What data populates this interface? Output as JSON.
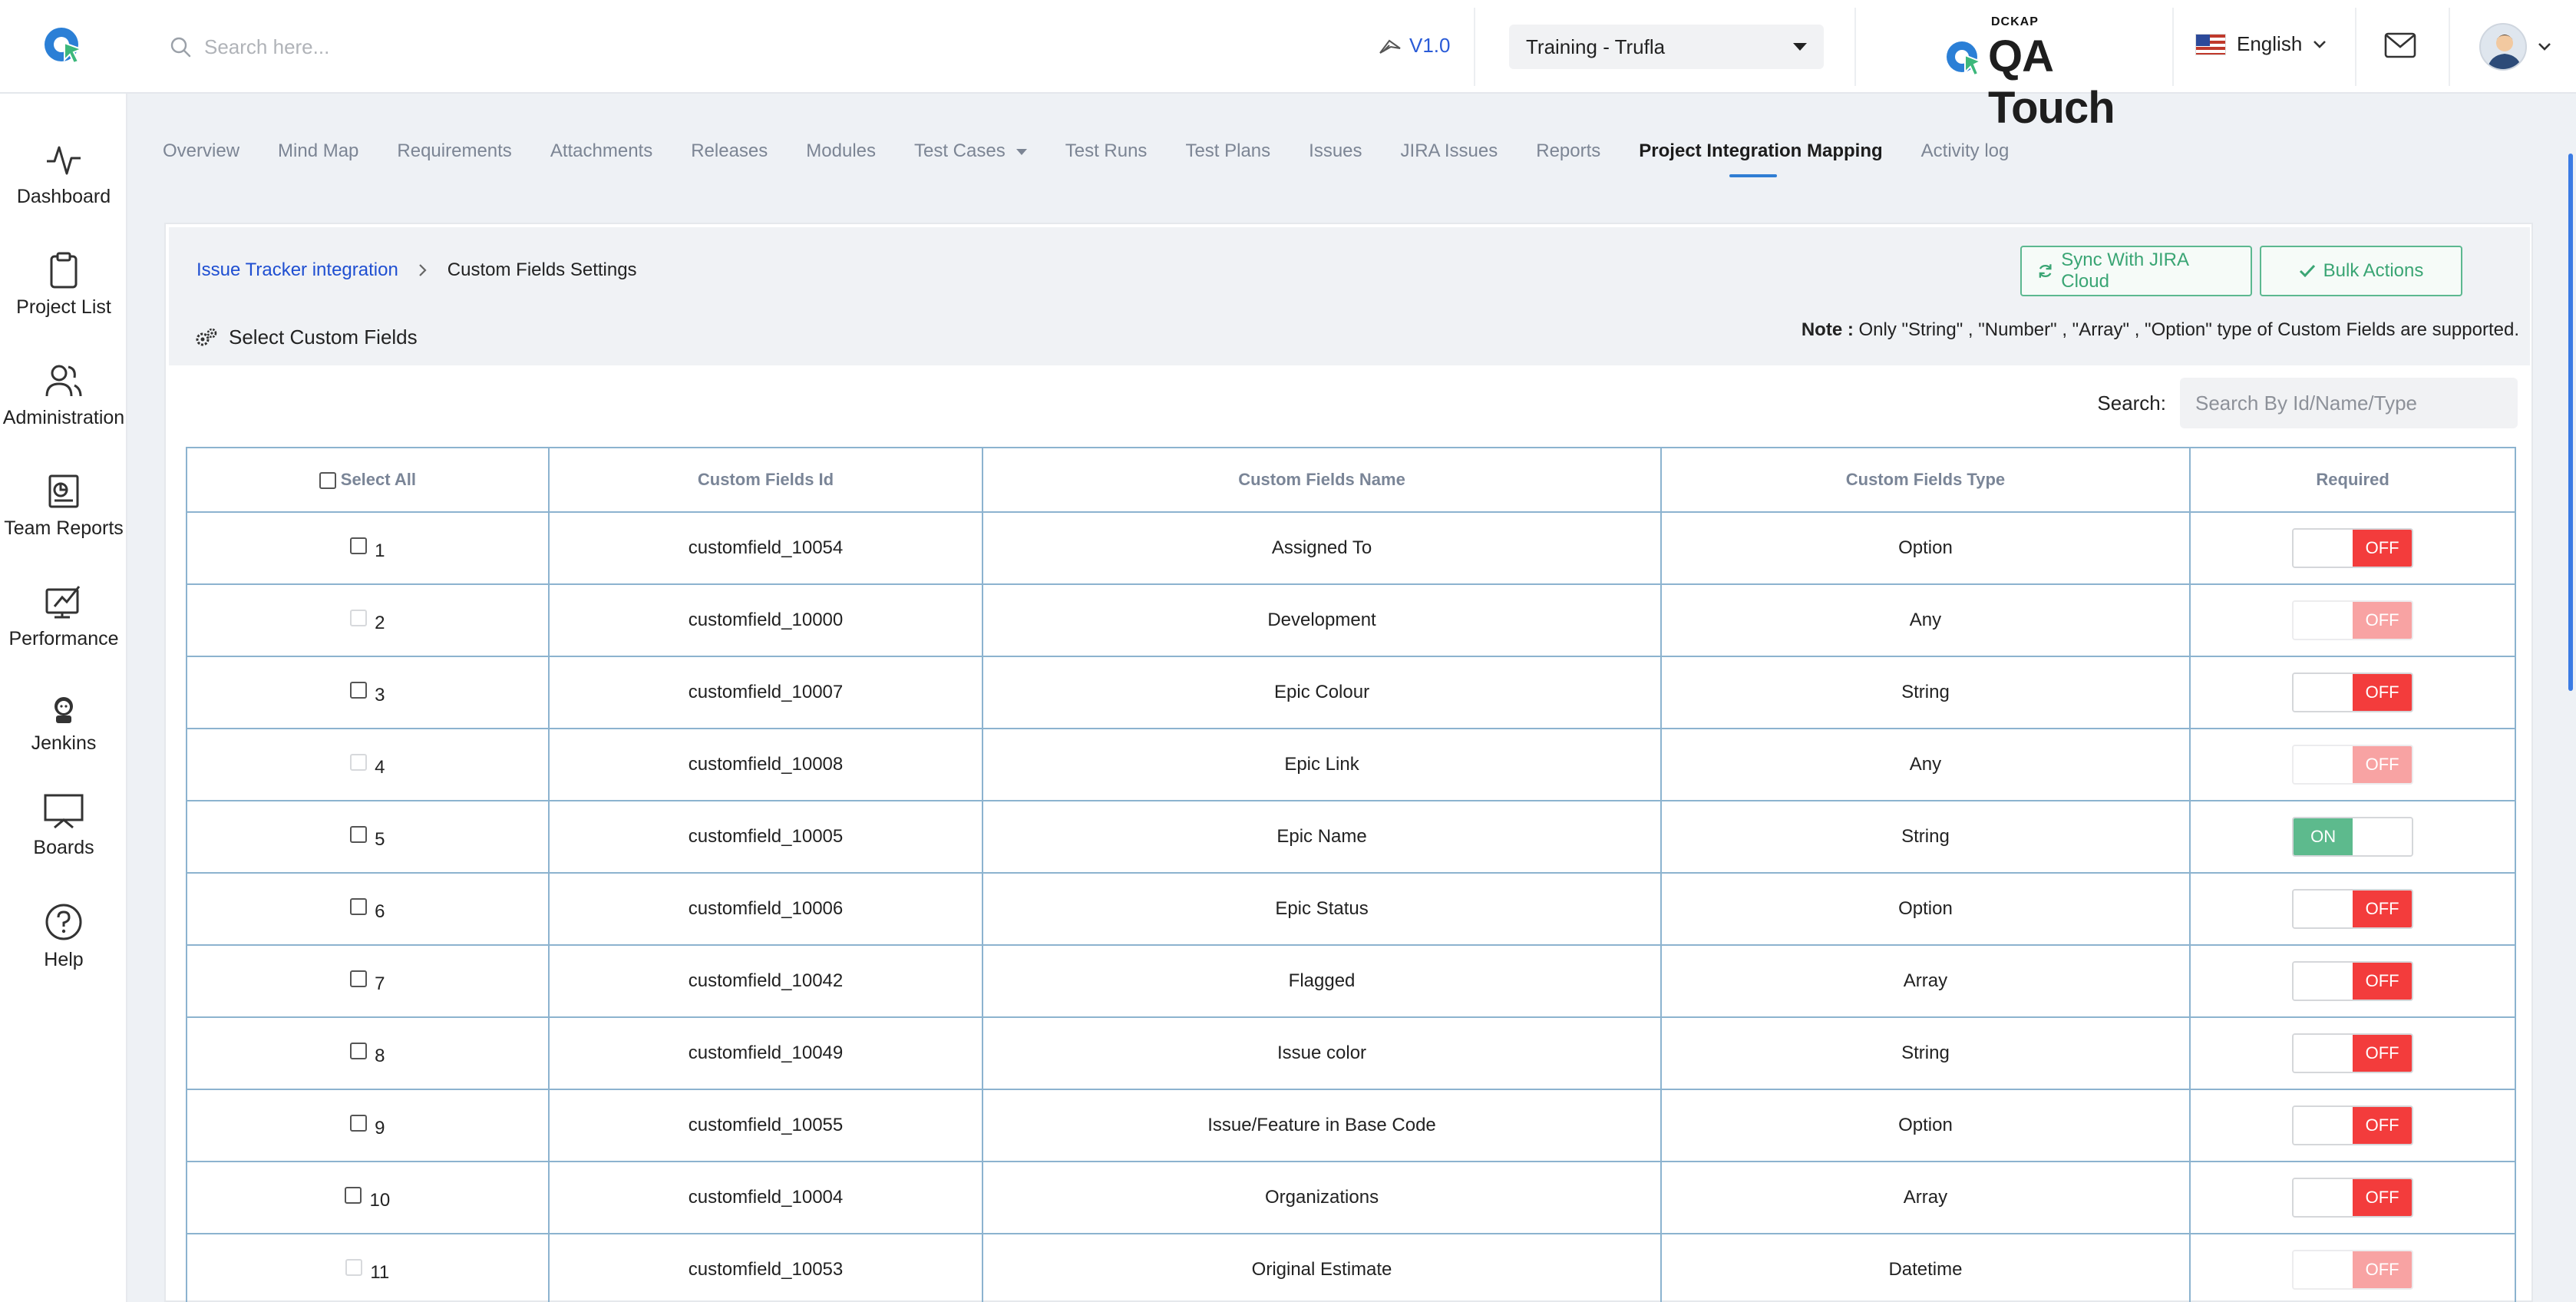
{
  "header": {
    "search_placeholder": "Search here...",
    "version": "V1.0",
    "project": "Training - Trufla",
    "brand_top": "DCKAP",
    "brand_name": "QA Touch",
    "language": "English"
  },
  "sidebar": {
    "items": [
      {
        "label": "Dashboard",
        "icon": "activity-icon"
      },
      {
        "label": "Project List",
        "icon": "clipboard-icon"
      },
      {
        "label": "Administration",
        "icon": "users-icon"
      },
      {
        "label": "Team Reports",
        "icon": "report-icon"
      },
      {
        "label": "Performance",
        "icon": "performance-icon"
      },
      {
        "label": "Jenkins",
        "icon": "jenkins-icon"
      },
      {
        "label": "Boards",
        "icon": "board-icon"
      },
      {
        "label": "Help",
        "icon": "help-icon"
      }
    ]
  },
  "tabs": [
    {
      "label": "Overview"
    },
    {
      "label": "Mind Map"
    },
    {
      "label": "Requirements"
    },
    {
      "label": "Attachments"
    },
    {
      "label": "Releases"
    },
    {
      "label": "Modules"
    },
    {
      "label": "Test Cases"
    },
    {
      "label": "Test Runs"
    },
    {
      "label": "Test Plans"
    },
    {
      "label": "Issues"
    },
    {
      "label": "JIRA Issues"
    },
    {
      "label": "Reports"
    },
    {
      "label": "Project Integration Mapping"
    },
    {
      "label": "Activity log"
    }
  ],
  "panel": {
    "breadcrumb_link": "Issue Tracker integration",
    "breadcrumb_current": "Custom Fields Settings",
    "sync_button": "Sync With JIRA Cloud",
    "bulk_button": "Bulk Actions",
    "section_title": "Select Custom Fields",
    "note_label": "Note :",
    "note_text": " Only \"String\" , \"Number\" , \"Array\" , \"Option\" type of Custom Fields are supported.",
    "search_label": "Search:",
    "search_placeholder": "Search By Id/Name/Type"
  },
  "table": {
    "headers": {
      "select_all": "Select All",
      "id": "Custom Fields Id",
      "name": "Custom Fields Name",
      "type": "Custom Fields Type",
      "required": "Required"
    },
    "rows": [
      {
        "num": "1",
        "id": "customfield_10054",
        "name": "Assigned To",
        "type": "Option",
        "required": "OFF",
        "enabled": true
      },
      {
        "num": "2",
        "id": "customfield_10000",
        "name": "Development",
        "type": "Any",
        "required": "OFF",
        "enabled": false
      },
      {
        "num": "3",
        "id": "customfield_10007",
        "name": "Epic Colour",
        "type": "String",
        "required": "OFF",
        "enabled": true
      },
      {
        "num": "4",
        "id": "customfield_10008",
        "name": "Epic Link",
        "type": "Any",
        "required": "OFF",
        "enabled": false
      },
      {
        "num": "5",
        "id": "customfield_10005",
        "name": "Epic Name",
        "type": "String",
        "required": "ON",
        "enabled": true
      },
      {
        "num": "6",
        "id": "customfield_10006",
        "name": "Epic Status",
        "type": "Option",
        "required": "OFF",
        "enabled": true
      },
      {
        "num": "7",
        "id": "customfield_10042",
        "name": "Flagged",
        "type": "Array",
        "required": "OFF",
        "enabled": true
      },
      {
        "num": "8",
        "id": "customfield_10049",
        "name": "Issue color",
        "type": "String",
        "required": "OFF",
        "enabled": true
      },
      {
        "num": "9",
        "id": "customfield_10055",
        "name": "Issue/Feature in Base Code",
        "type": "Option",
        "required": "OFF",
        "enabled": true
      },
      {
        "num": "10",
        "id": "customfield_10004",
        "name": "Organizations",
        "type": "Array",
        "required": "OFF",
        "enabled": true
      },
      {
        "num": "11",
        "id": "customfield_10053",
        "name": "Original Estimate",
        "type": "Datetime",
        "required": "OFF",
        "enabled": false
      }
    ]
  },
  "colors": {
    "accent": "#2f7dd3",
    "off": "#f33c3c",
    "on": "#5dba8d",
    "link": "#1f4fd1"
  }
}
